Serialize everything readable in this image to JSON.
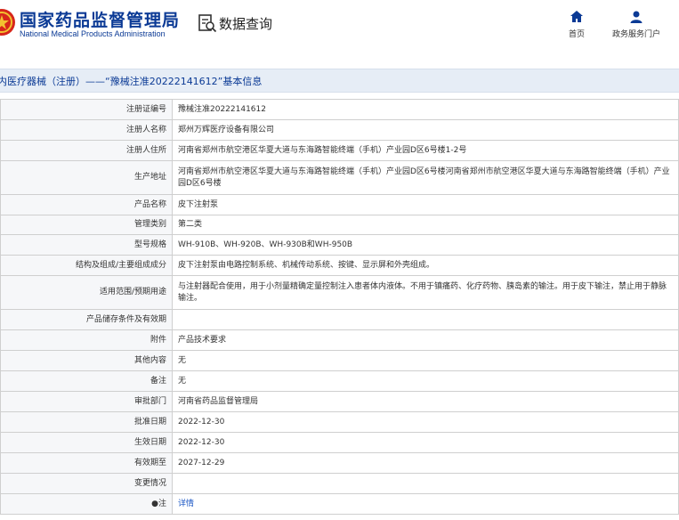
{
  "header": {
    "site_title_cn": "国家药品监督管理局",
    "site_title_en": "National Medical Products Administration",
    "query_label": "数据查询",
    "nav": [
      {
        "label": "首页",
        "icon": "home-icon"
      },
      {
        "label": "政务服务门户",
        "icon": "user-icon"
      }
    ]
  },
  "colors": {
    "brand": "#0b3a95",
    "title_bar": "#e6edf6",
    "link": "#1a56c4",
    "logo_red": "#d7261a",
    "logo_gold": "#f2c230"
  },
  "page": {
    "title": "内医疗器械（注册）——“豫械注准20222141612”基本信息"
  },
  "rows": [
    {
      "label": "注册证编号",
      "value": "豫械注准20222141612"
    },
    {
      "label": "注册人名称",
      "value": "郑州万辉医疗设备有限公司"
    },
    {
      "label": "注册人住所",
      "value": "河南省郑州市航空港区华夏大道与东海路智能终端（手机）产业园D区6号楼1-2号"
    },
    {
      "label": "生产地址",
      "value": "河南省郑州市航空港区华夏大道与东海路智能终端（手机）产业园D区6号楼河南省郑州市航空港区华夏大道与东海路智能终端（手机）产业园D区6号楼"
    },
    {
      "label": "产品名称",
      "value": "皮下注射泵"
    },
    {
      "label": "管理类别",
      "value": "第二类"
    },
    {
      "label": "型号规格",
      "value": "WH-910B、WH-920B、WH-930B和WH-950B"
    },
    {
      "label": "结构及组成/主要组成成分",
      "value": "皮下注射泵由电路控制系统、机械传动系统、按键、显示屏和外壳组成。"
    },
    {
      "label": "适用范围/预期用途",
      "value": "与注射器配合使用，用于小剂量精确定量控制注入患者体内液体。不用于镇痛药、化疗药物、胰岛素的输注。用于皮下输注，禁止用于静脉输注。"
    },
    {
      "label": "产品储存条件及有效期",
      "value": ""
    },
    {
      "label": "附件",
      "value": "产品技术要求"
    },
    {
      "label": "其他内容",
      "value": "无"
    },
    {
      "label": "备注",
      "value": "无"
    },
    {
      "label": "审批部门",
      "value": "河南省药品监督管理局"
    },
    {
      "label": "批准日期",
      "value": "2022-12-30"
    },
    {
      "label": "生效日期",
      "value": "2022-12-30"
    },
    {
      "label": "有效期至",
      "value": "2027-12-29"
    },
    {
      "label": "变更情况",
      "value": ""
    },
    {
      "label": "●注",
      "value": "详情"
    }
  ]
}
